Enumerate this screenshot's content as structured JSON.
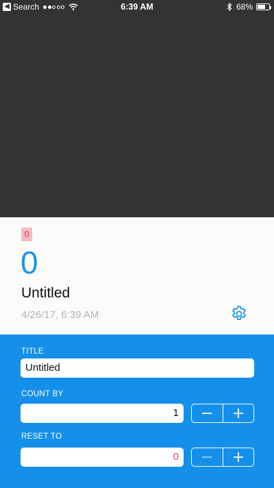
{
  "status_bar": {
    "back_badge": "◀",
    "back_label": "Search",
    "time": "6:39 AM",
    "battery": "68%",
    "battery_level": 0.68,
    "signal_bars_filled": 2,
    "signal_bars_total": 5
  },
  "counter": {
    "badge": "0",
    "value": "0",
    "title": "Untitled",
    "timestamp": "4/26/17, 6:39 AM"
  },
  "editor": {
    "title_label": "TITLE",
    "title_value": "Untitled",
    "count_by_label": "COUNT BY",
    "count_by_value": "1",
    "reset_to_label": "RESET TO",
    "reset_to_value": "0"
  },
  "colors": {
    "accent": "#1590ea",
    "counter_text": "#1e92e8",
    "badge_bg": "#f6b9c0",
    "alert_text": "#e14a4a",
    "dark_bg": "#333333"
  }
}
